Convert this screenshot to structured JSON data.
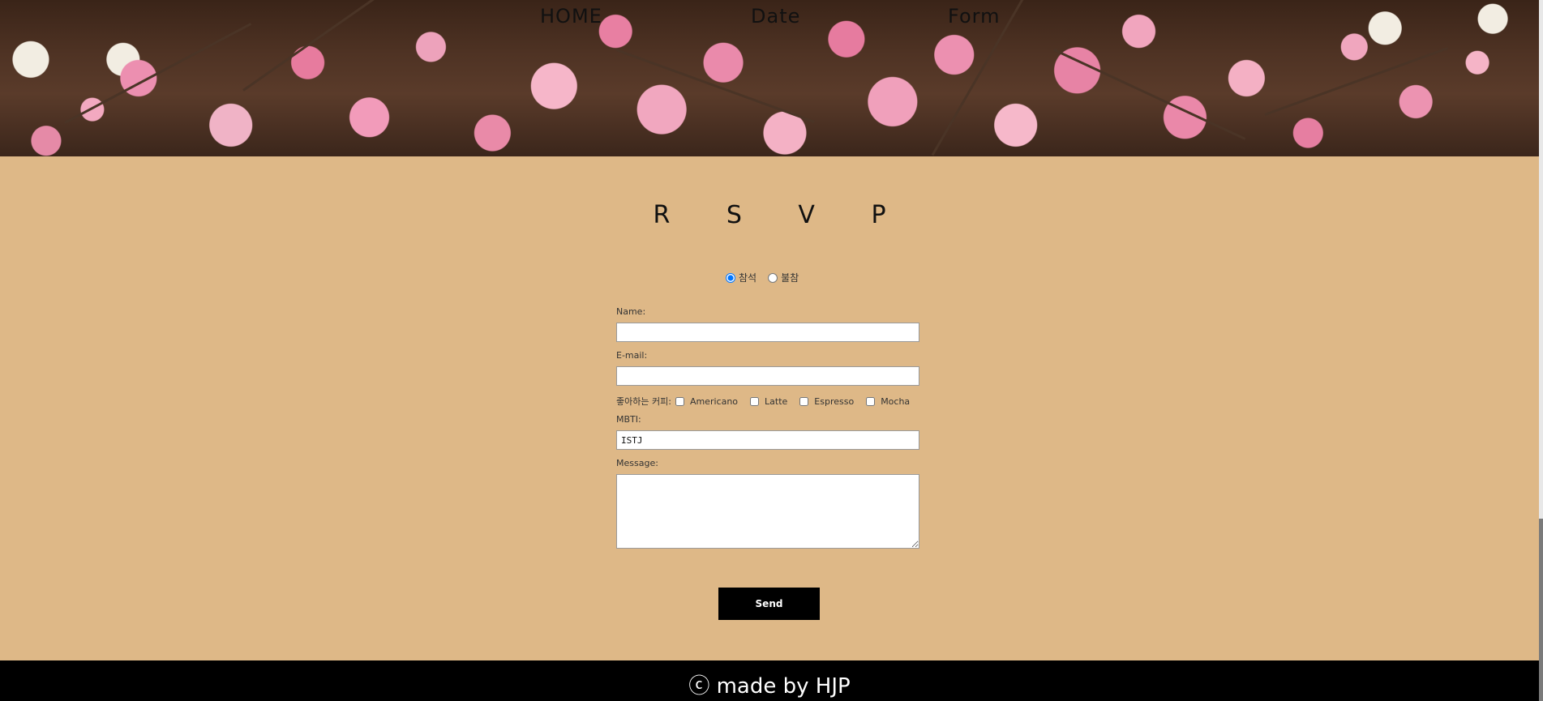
{
  "nav": {
    "items": [
      {
        "label": "HOME"
      },
      {
        "label": "Date"
      },
      {
        "label": "Form"
      }
    ]
  },
  "rsvp": {
    "title": "R S V P",
    "attendance": [
      {
        "label": "참석",
        "checked": true
      },
      {
        "label": "불참",
        "checked": false
      }
    ]
  },
  "form": {
    "name_label": "Name:",
    "name_value": "",
    "email_label": "E-mail:",
    "email_value": "",
    "coffee_label": "좋아하는 커피:",
    "coffee_options": [
      {
        "label": "Americano",
        "checked": false
      },
      {
        "label": "Latte",
        "checked": false
      },
      {
        "label": "Espresso",
        "checked": false
      },
      {
        "label": "Mocha",
        "checked": false
      }
    ],
    "mbti_label": "MBTI:",
    "mbti_value": "ISTJ",
    "message_label": "Message:",
    "message_value": "",
    "send_label": "Send"
  },
  "footer": {
    "text": "ⓒ made by HJP"
  },
  "colors": {
    "page_background": "#deb887",
    "button_background": "#000000",
    "footer_background": "#000000"
  }
}
